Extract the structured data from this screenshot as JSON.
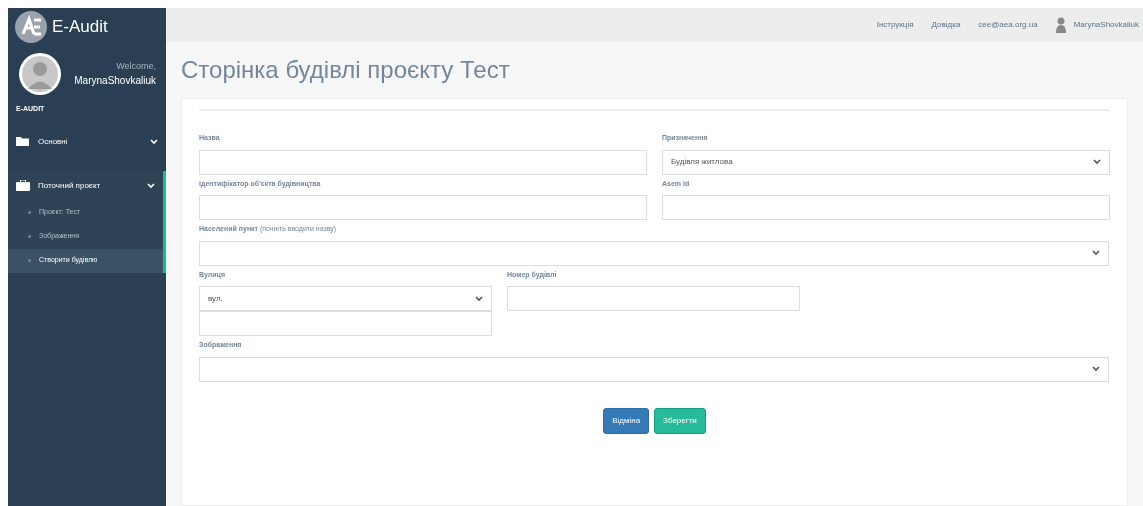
{
  "brand": {
    "title": "E-Audit"
  },
  "profile": {
    "welcome": "Welcome,",
    "name": "MarynaShovkaliuk"
  },
  "sidebar": {
    "section": "E-AUDIT",
    "items": [
      {
        "kind": "folder",
        "label": "Основні",
        "selected": false
      },
      {
        "kind": "briefcase",
        "label": "Поточний проєкт",
        "selected": true,
        "children": [
          {
            "label": "Проєкт: Тест",
            "selected": false
          },
          {
            "label": "Зображення",
            "selected": false
          },
          {
            "label": "Створити будівлю",
            "selected": true
          }
        ]
      }
    ]
  },
  "top_nav": {
    "links": [
      "Інструкція",
      "Довідка",
      "cee@aea.org.ua"
    ],
    "user": "MarynaShovkaliuk"
  },
  "page_title": "Сторінка будівлі проєкту Тест",
  "form": {
    "rows": [
      [
        {
          "label": "Назва",
          "kind": "text"
        },
        {
          "label": "Призначення",
          "kind": "select",
          "value": "Будівля житлова"
        }
      ],
      [
        {
          "label": "Ідентифікатор об'єкта будівництва",
          "kind": "text"
        },
        {
          "label": "Asem id",
          "kind": "text"
        }
      ],
      [
        {
          "label": "Населений пункт",
          "hint": "(почніть вводити назву)",
          "kind": "select"
        }
      ],
      [
        {
          "label": "Вулиця",
          "kind": "street",
          "value": "вул."
        },
        {
          "label": "Номер будівлі",
          "kind": "text"
        }
      ],
      [
        {
          "label": "Зображення",
          "kind": "select"
        }
      ]
    ]
  },
  "buttons": [
    {
      "label": "Відміна",
      "kind": "cancel"
    },
    {
      "label": "Зберегти",
      "kind": "save"
    }
  ]
}
